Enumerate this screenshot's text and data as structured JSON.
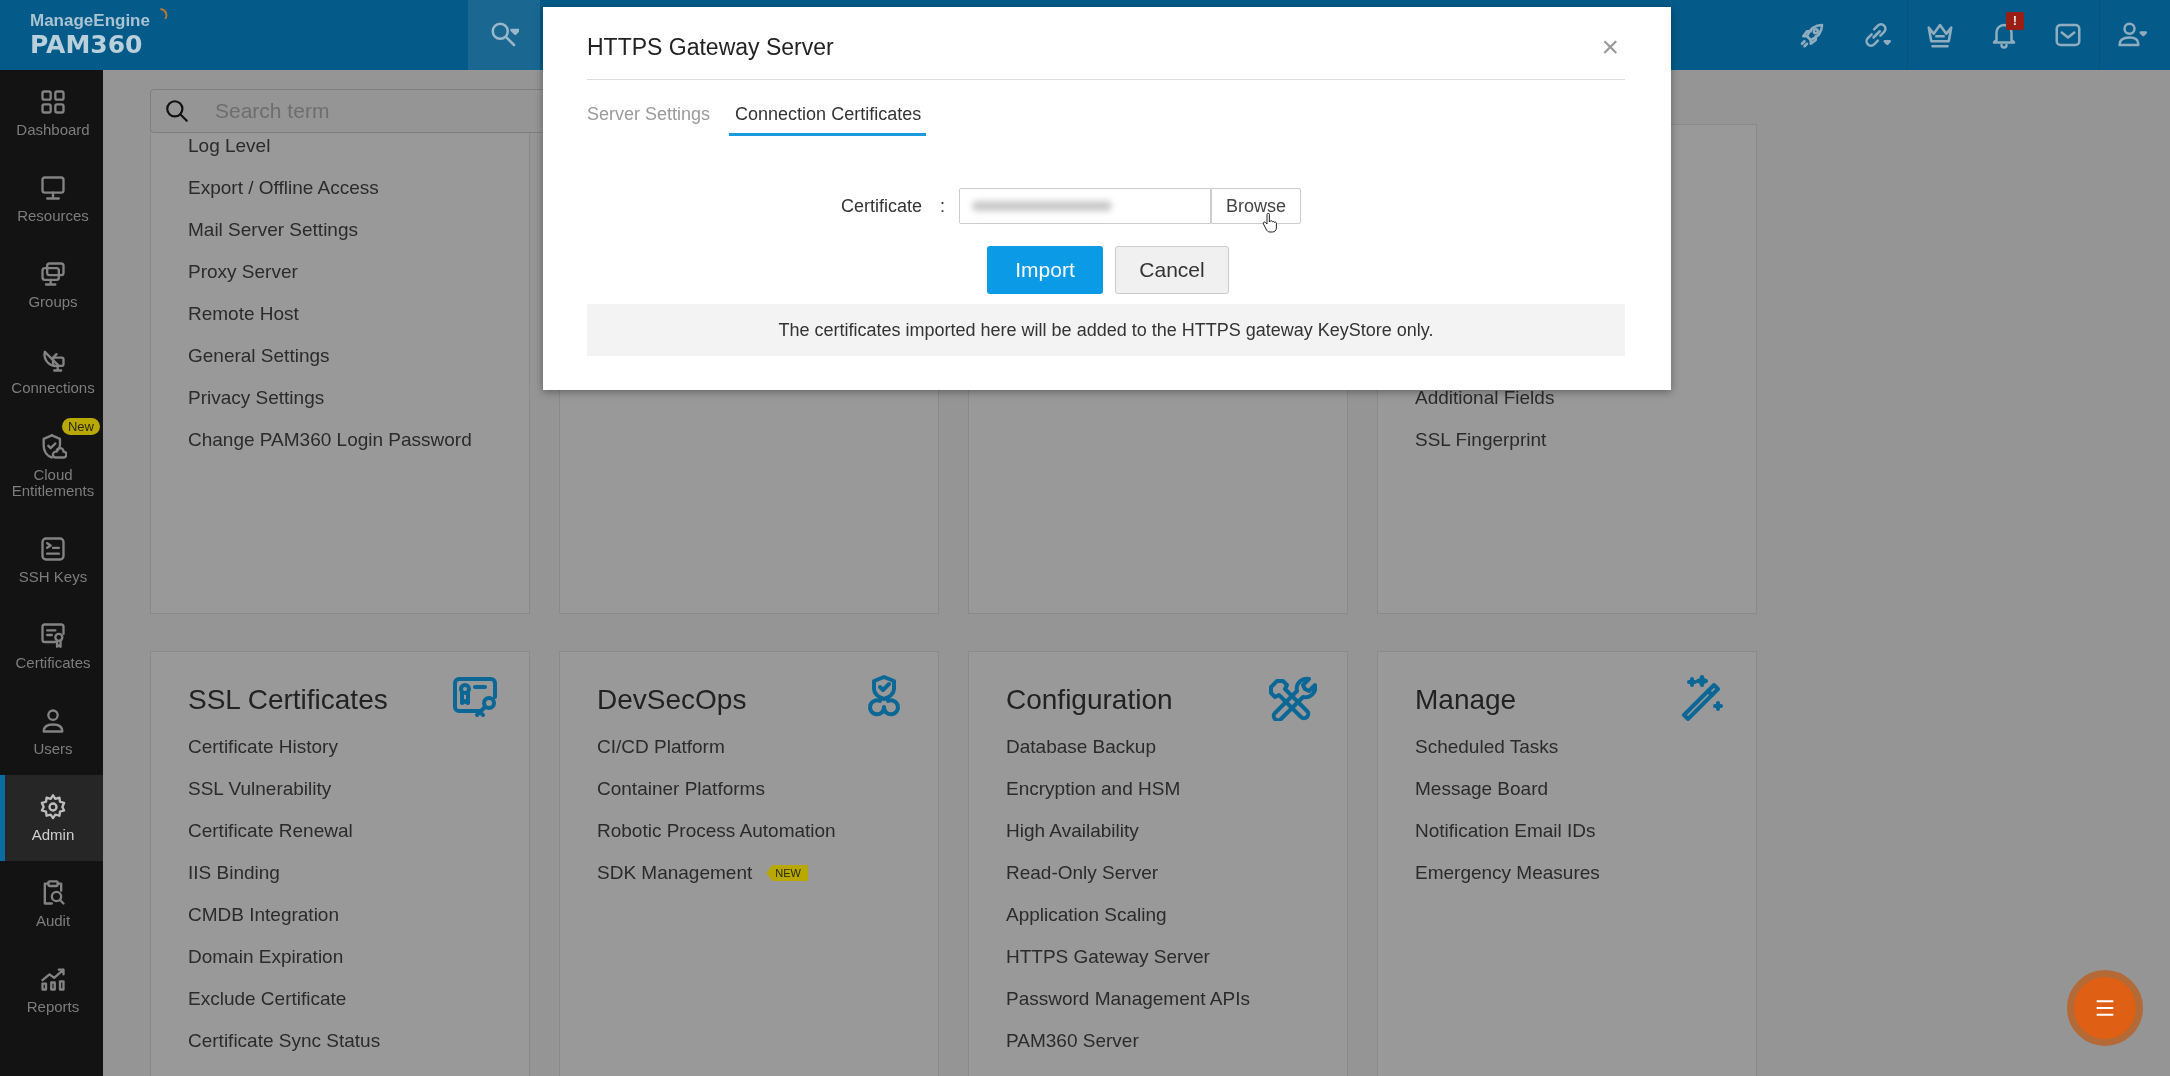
{
  "topbar": {
    "brand": "ManageEngine",
    "product": "PAM360",
    "icons": [
      {
        "kind": "rocket"
      },
      {
        "kind": "link"
      },
      {
        "kind": "crown"
      },
      {
        "kind": "bell",
        "badge": "!"
      },
      {
        "kind": "mail"
      },
      {
        "kind": "user"
      }
    ]
  },
  "sidebar": {
    "items": [
      {
        "label": "Dashboard",
        "kind": "dashboard",
        "selected": false
      },
      {
        "label": "Resources",
        "kind": "monitor",
        "selected": false
      },
      {
        "label": "Groups",
        "kind": "groups",
        "selected": false
      },
      {
        "label": "Connections",
        "kind": "connections",
        "selected": false
      },
      {
        "label": "Cloud Entitlements",
        "kind": "cloud",
        "selected": false,
        "badge": "New"
      },
      {
        "label": "SSH Keys",
        "kind": "ssh",
        "selected": false
      },
      {
        "label": "Certificates",
        "kind": "certificate",
        "selected": false
      },
      {
        "label": "Users",
        "kind": "user",
        "selected": false
      },
      {
        "label": "Admin",
        "kind": "gear",
        "selected": true
      },
      {
        "label": "Audit",
        "kind": "audit",
        "selected": false
      },
      {
        "label": "Reports",
        "kind": "reports",
        "selected": false
      }
    ]
  },
  "search": {
    "placeholder": "Search term"
  },
  "top_cards": [
    {
      "items": [
        {
          "label": "Log Level"
        },
        {
          "label": "Export / Offline Access"
        },
        {
          "label": "Mail Server Settings"
        },
        {
          "label": "Proxy Server"
        },
        {
          "label": "Remote Host"
        },
        {
          "label": "General Settings"
        },
        {
          "label": "Privacy Settings"
        },
        {
          "label": "Change PAM360 Login Password"
        }
      ]
    },
    {
      "items": [
        {
          "label": "Additional Fields"
        },
        {
          "label": "SSL Fingerprint"
        }
      ]
    }
  ],
  "cards": [
    {
      "title": "SSL Certificates",
      "items": [
        {
          "label": "Certificate History"
        },
        {
          "label": "SSL Vulnerability"
        },
        {
          "label": "Certificate Renewal"
        },
        {
          "label": "IIS Binding"
        },
        {
          "label": "CMDB Integration"
        },
        {
          "label": "Domain Expiration"
        },
        {
          "label": "Exclude Certificate"
        },
        {
          "label": "Certificate Sync Status"
        }
      ]
    },
    {
      "title": "DevSecOps",
      "items": [
        {
          "label": "CI/CD Platform"
        },
        {
          "label": "Container Platforms"
        },
        {
          "label": "Robotic Process Automation"
        },
        {
          "label": "SDK Management",
          "badge": "NEW"
        }
      ]
    },
    {
      "title": "Configuration",
      "items": [
        {
          "label": "Database Backup"
        },
        {
          "label": "Encryption and HSM"
        },
        {
          "label": "High Availability"
        },
        {
          "label": "Read-Only Server"
        },
        {
          "label": "Application Scaling"
        },
        {
          "label": "HTTPS Gateway Server"
        },
        {
          "label": "Password Management APIs"
        },
        {
          "label": "PAM360 Server"
        }
      ]
    },
    {
      "title": "Manage",
      "items": [
        {
          "label": "Scheduled Tasks"
        },
        {
          "label": "Message Board"
        },
        {
          "label": "Notification Email IDs"
        },
        {
          "label": "Emergency Measures"
        }
      ]
    }
  ],
  "dialog": {
    "title": "HTTPS Gateway Server",
    "close": "×",
    "tabs": [
      {
        "label": "Server Settings",
        "selected": false
      },
      {
        "label": "Connection Certificates",
        "selected": true
      }
    ],
    "field": {
      "label": "Certificate",
      "separator": ":",
      "blurred": true,
      "button": "Browse"
    },
    "buttons": [
      {
        "label": "Import",
        "kind": "primary"
      },
      {
        "label": "Cancel",
        "kind": "secondary"
      }
    ],
    "note": "The certificates imported here will be added to the HTTPS gateway KeyStore only."
  }
}
